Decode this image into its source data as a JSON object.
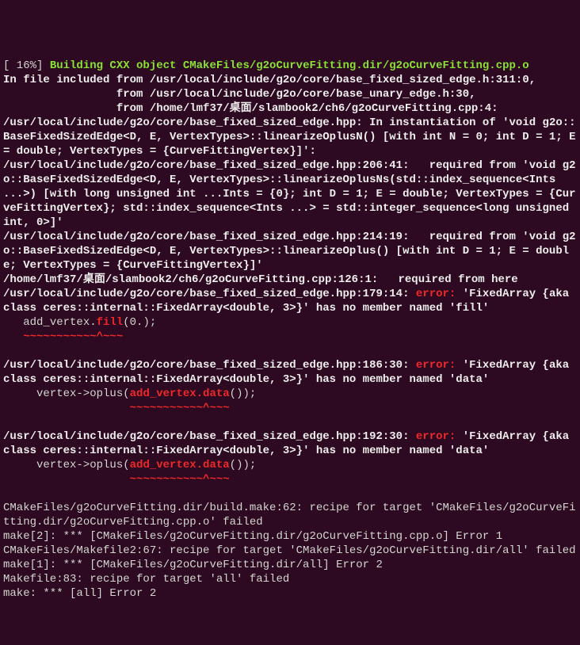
{
  "l1_prefix": "[ 16%] ",
  "l1_building": "Building CXX object CMakeFiles/g2oCurveFitting.dir/g2oCurveFitting.cpp.o",
  "l2a": "In file included from ",
  "l2b": "/usr/local/include/g2o/core/base_fixed_sized_edge.h:311:0",
  "l2c": ",",
  "l3a": "                 from ",
  "l3b": "/usr/local/include/g2o/core/base_unary_edge.h:30",
  "l3c": ",",
  "l4a": "                 from ",
  "l4b": "/home/lmf37/桌面/slambook2/ch6/g2oCurveFitting.cpp:4",
  "l4c": ":",
  "l5a": "/usr/local/include/g2o/core/base_fixed_sized_edge.hpp:",
  "l5b": " In instantiation of '",
  "l5c": "void g2o::BaseFixedSizedEdge<D, E, VertexTypes>::linearizeOplusN() [with int N = 0; int D = 1; E = double; VertexTypes = {CurveFittingVertex}]",
  "l5d": "':",
  "l6a": "/usr/local/include/g2o/core/base_fixed_sized_edge.hpp:206:41:",
  "l6b": "   required from '",
  "l6c": "void g2o::BaseFixedSizedEdge<D, E, VertexTypes>::linearizeOplusNs(std::index_sequence<Ints ...>) [with long unsigned int ...Ints = {0}; int D = 1; E = double; VertexTypes = {CurveFittingVertex}; std::index_sequence<Ints ...> = std::integer_sequence<long unsigned int, 0>]",
  "l6d": "'",
  "l7a": "/usr/local/include/g2o/core/base_fixed_sized_edge.hpp:214:19:",
  "l7b": "   required from '",
  "l7c": "void g2o::BaseFixedSizedEdge<D, E, VertexTypes>::linearizeOplus() [with int D = 1; E = double; VertexTypes = {CurveFittingVertex}]",
  "l7d": "'",
  "l8a": "/home/lmf37/桌面/slambook2/ch6/g2oCurveFitting.cpp:126:1:",
  "l8b": "   required from here",
  "l9a": "/usr/local/include/g2o/core/base_fixed_sized_edge.hpp:179:14:",
  "l9b": " ",
  "l9err": "error:",
  "l9c": " '",
  "l9d": "FixedArray {aka class ceres::internal::FixedArray<double, 3>}",
  "l9e": "' has no member named '",
  "l9f": "fill",
  "l9g": "'",
  "l10a": "   add_vertex.",
  "l10b": "fill",
  "l10c": "(0.);",
  "l10u": "   ~~~~~~~~~~~^~~~",
  "l11a": "/usr/local/include/g2o/core/base_fixed_sized_edge.hpp:186:30:",
  "l11err": "error:",
  "l11c": " '",
  "l11d": "FixedArray {aka class ceres::internal::FixedArray<double, 3>}",
  "l11e": "' has no member named '",
  "l11f": "data",
  "l11g": "'",
  "l12a": "     vertex->oplus(",
  "l12b": "add_vertex.data",
  "l12c": "());",
  "l12u": "                   ~~~~~~~~~~~^~~~",
  "l13a": "/usr/local/include/g2o/core/base_fixed_sized_edge.hpp:192:30:",
  "l13err": "error:",
  "l13c": " '",
  "l13d": "FixedArray {aka class ceres::internal::FixedArray<double, 3>}",
  "l13e": "' has no member named '",
  "l13f": "data",
  "l13g": "'",
  "l14a": "     vertex->oplus(",
  "l14b": "add_vertex.data",
  "l14c": "());",
  "l14u": "                   ~~~~~~~~~~~^~~~",
  "l15": "CMakeFiles/g2oCurveFitting.dir/build.make:62: recipe for target 'CMakeFiles/g2oCurveFitting.dir/g2oCurveFitting.cpp.o' failed",
  "l16": "make[2]: *** [CMakeFiles/g2oCurveFitting.dir/g2oCurveFitting.cpp.o] Error 1",
  "l17": "CMakeFiles/Makefile2:67: recipe for target 'CMakeFiles/g2oCurveFitting.dir/all' failed",
  "l18": "make[1]: *** [CMakeFiles/g2oCurveFitting.dir/all] Error 2",
  "l19": "Makefile:83: recipe for target 'all' failed",
  "l20": "make: *** [all] Error 2"
}
